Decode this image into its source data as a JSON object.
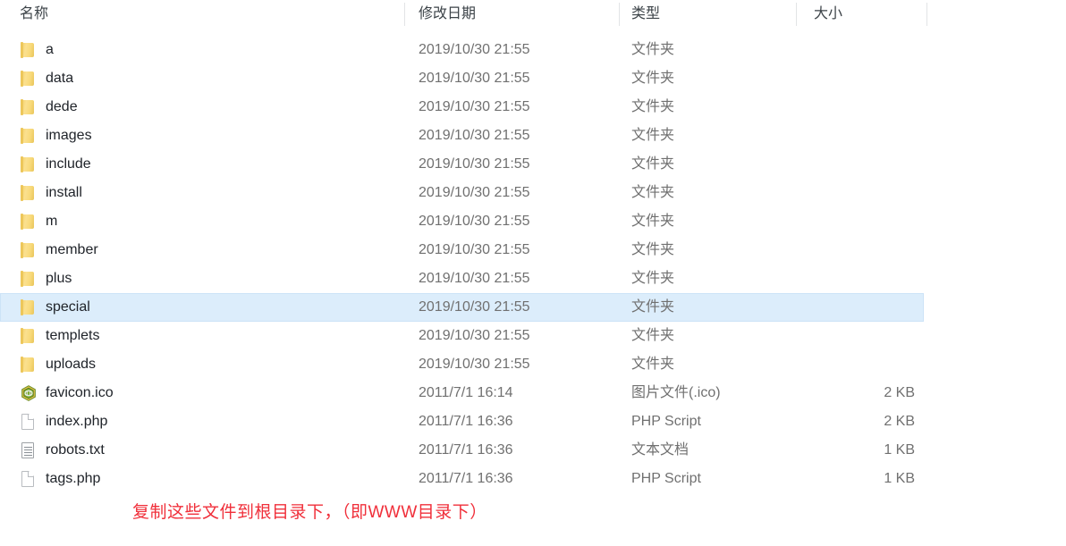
{
  "columns": {
    "name": "名称",
    "date": "修改日期",
    "type": "类型",
    "size": "大小"
  },
  "colors": {
    "selection_fill": "#dcedfb",
    "selection_border": "#cce3f7",
    "folder_yellow": "#f8d979",
    "annotation_red": "#f02f3a",
    "header_text": "#3c4348",
    "primary_text": "#20242a",
    "secondary_text": "#707070"
  },
  "rows": [
    {
      "icon": "folder-icon",
      "name": "a",
      "date": "2019/10/30 21:55",
      "type": "文件夹",
      "size": "",
      "selected": false
    },
    {
      "icon": "folder-icon",
      "name": "data",
      "date": "2019/10/30 21:55",
      "type": "文件夹",
      "size": "",
      "selected": false
    },
    {
      "icon": "folder-icon",
      "name": "dede",
      "date": "2019/10/30 21:55",
      "type": "文件夹",
      "size": "",
      "selected": false
    },
    {
      "icon": "folder-icon",
      "name": "images",
      "date": "2019/10/30 21:55",
      "type": "文件夹",
      "size": "",
      "selected": false
    },
    {
      "icon": "folder-icon",
      "name": "include",
      "date": "2019/10/30 21:55",
      "type": "文件夹",
      "size": "",
      "selected": false
    },
    {
      "icon": "folder-icon",
      "name": "install",
      "date": "2019/10/30 21:55",
      "type": "文件夹",
      "size": "",
      "selected": false
    },
    {
      "icon": "folder-icon",
      "name": "m",
      "date": "2019/10/30 21:55",
      "type": "文件夹",
      "size": "",
      "selected": false
    },
    {
      "icon": "folder-icon",
      "name": "member",
      "date": "2019/10/30 21:55",
      "type": "文件夹",
      "size": "",
      "selected": false
    },
    {
      "icon": "folder-icon",
      "name": "plus",
      "date": "2019/10/30 21:55",
      "type": "文件夹",
      "size": "",
      "selected": false
    },
    {
      "icon": "folder-icon",
      "name": "special",
      "date": "2019/10/30 21:55",
      "type": "文件夹",
      "size": "",
      "selected": true
    },
    {
      "icon": "folder-icon",
      "name": "templets",
      "date": "2019/10/30 21:55",
      "type": "文件夹",
      "size": "",
      "selected": false
    },
    {
      "icon": "folder-icon",
      "name": "uploads",
      "date": "2019/10/30 21:55",
      "type": "文件夹",
      "size": "",
      "selected": false
    },
    {
      "icon": "favicon-icon",
      "name": "favicon.ico",
      "date": "2011/7/1 16:14",
      "type": "图片文件(.ico)",
      "size": "2 KB",
      "selected": false
    },
    {
      "icon": "php-file-icon",
      "name": "index.php",
      "date": "2011/7/1 16:36",
      "type": "PHP Script",
      "size": "2 KB",
      "selected": false
    },
    {
      "icon": "text-file-icon",
      "name": "robots.txt",
      "date": "2011/7/1 16:36",
      "type": "文本文档",
      "size": "1 KB",
      "selected": false
    },
    {
      "icon": "php-file-icon",
      "name": "tags.php",
      "date": "2011/7/1 16:36",
      "type": "PHP Script",
      "size": "1 KB",
      "selected": false
    }
  ],
  "annotation": {
    "text": "复制这些文件到根目录下，（即WWW目录下）"
  }
}
